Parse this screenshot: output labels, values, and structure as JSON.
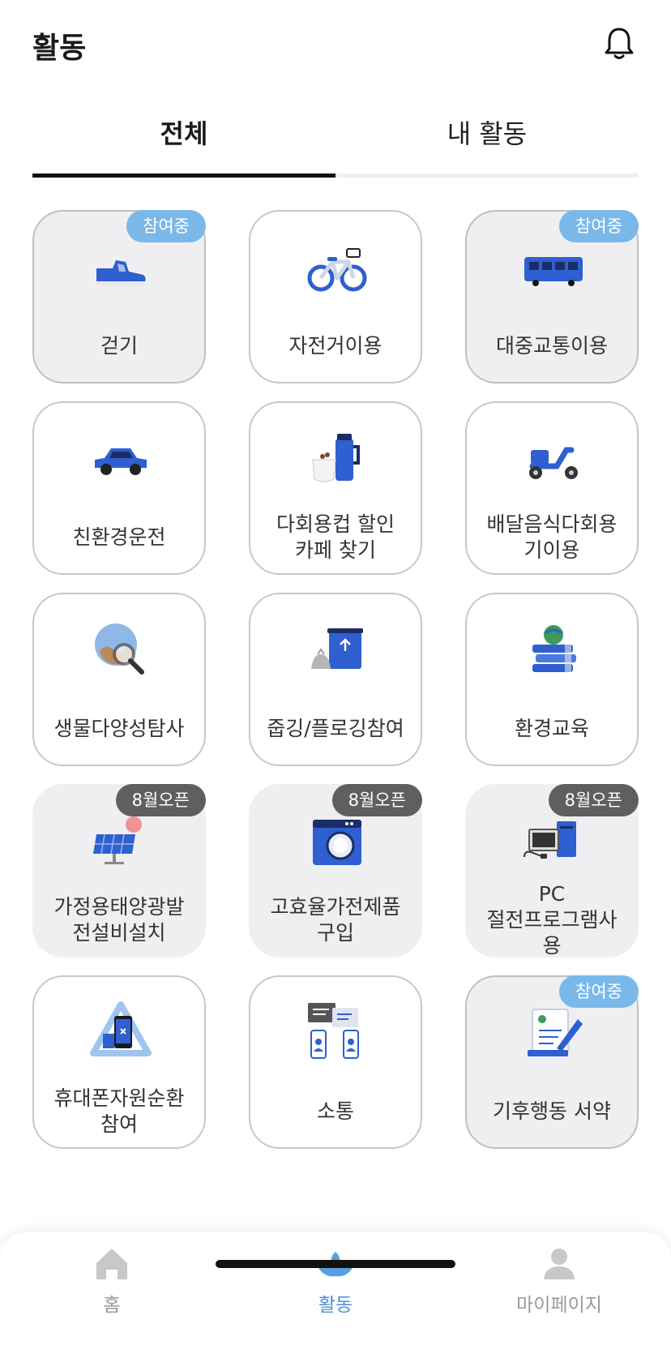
{
  "header": {
    "title": "활동"
  },
  "tabs": {
    "all": "전체",
    "mine": "내 활동"
  },
  "activities": [
    {
      "label": "걷기",
      "badge": "참여중",
      "icon": "sneaker-icon"
    },
    {
      "label": "자전거이용",
      "badge": "",
      "icon": "bicycle-icon"
    },
    {
      "label": "대중교통이용",
      "badge": "참여중",
      "icon": "bus-icon"
    },
    {
      "label": "친환경운전",
      "badge": "",
      "icon": "car-icon"
    },
    {
      "label": "다회용컵 할인\n카페 찾기",
      "badge": "",
      "icon": "tumbler-icon"
    },
    {
      "label": "배달음식다회용\n기이용",
      "badge": "",
      "icon": "scooter-icon"
    },
    {
      "label": "생물다양성탐사",
      "badge": "",
      "icon": "globe-magnifier-icon"
    },
    {
      "label": "줍깅/플로깅참여",
      "badge": "",
      "icon": "recycle-bin-icon"
    },
    {
      "label": "환경교육",
      "badge": "",
      "icon": "books-globe-icon"
    },
    {
      "label": "가정용태양광발\n전설비설치",
      "badge": "8월오픈",
      "icon": "solar-panel-icon"
    },
    {
      "label": "고효율가전제품\n구입",
      "badge": "8월오픈",
      "icon": "washing-machine-icon"
    },
    {
      "label": "PC\n절전프로그램사\n용",
      "badge": "8월오픈",
      "icon": "desktop-pc-icon"
    },
    {
      "label": "휴대폰자원순환\n참여",
      "badge": "",
      "icon": "phone-recycle-icon"
    },
    {
      "label": "소통",
      "badge": "",
      "icon": "chat-icon"
    },
    {
      "label": "기후행동 서약",
      "badge": "참여중",
      "icon": "pledge-document-icon"
    }
  ],
  "nav": {
    "home": "홈",
    "activity": "활동",
    "mypage": "마이페이지"
  },
  "colors": {
    "accent": "#4a90d9",
    "joined_badge": "#7ab8ea",
    "open_badge": "#5f5f5f",
    "icon_blue": "#2f5fd0"
  }
}
